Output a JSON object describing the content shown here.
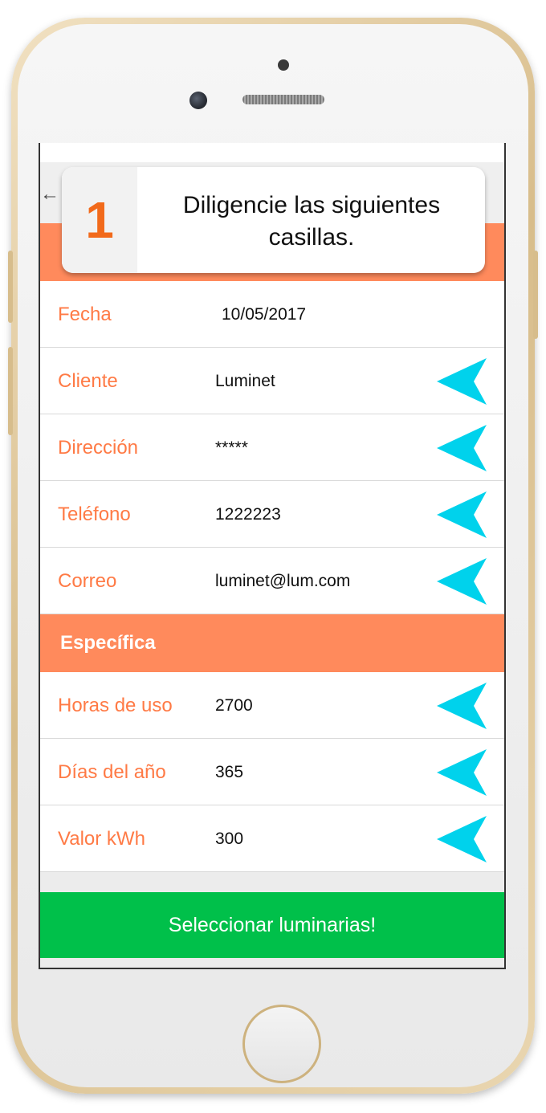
{
  "step": {
    "number": "1",
    "instruction": "Diligencie las siguientes casillas."
  },
  "toolbar": {
    "back_icon": "back-arrow-icon"
  },
  "fields": [
    {
      "label": "Fecha",
      "value": "10/05/2017"
    },
    {
      "label": "Cliente",
      "value": "Luminet"
    },
    {
      "label": "Dirección",
      "value": "*****"
    },
    {
      "label": "Teléfono",
      "value": "1222223"
    },
    {
      "label": "Correo",
      "value": "luminet@lum.com"
    }
  ],
  "section": {
    "title": "Específica"
  },
  "specific_fields": [
    {
      "label": "Horas de uso",
      "value": "2700"
    },
    {
      "label": "Días del año",
      "value": "365"
    },
    {
      "label": "Valor kWh",
      "value": "300"
    }
  ],
  "action": {
    "label": "Seleccionar luminarias!"
  },
  "colors": {
    "accent_orange": "#ff8a5c",
    "label_orange": "#ff7a45",
    "step_orange": "#f26a1b",
    "arrow_cyan": "#00d2ec",
    "button_green": "#00c04a"
  }
}
